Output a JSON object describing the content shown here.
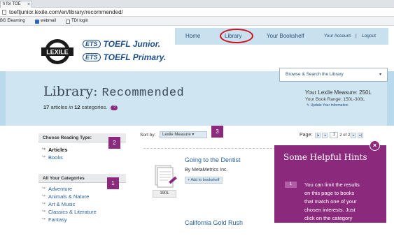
{
  "browser": {
    "tab_title": "h for TOE",
    "tab_close": "×",
    "url": "toefljunior.lexile.com/en/library/recommended/",
    "bookmarks": [
      "BG Elearning",
      "webmail",
      "TDI login"
    ]
  },
  "brand": {
    "lexile_logo_text": "LEXILE",
    "ets_badge": "ETS",
    "junior_name": "TOEFL Junior.",
    "primary_name": "TOEFL Primary."
  },
  "nav": {
    "home": "Home",
    "library": "Library",
    "bookshelf": "Your Bookshelf",
    "account": "Your Account",
    "separator": "|",
    "logout": "Logout"
  },
  "browse": {
    "label": "Browse & Search the Library",
    "caret": "▾"
  },
  "hero": {
    "title_prefix": "Library:",
    "title_suffix": "Recommended",
    "article_count": "17",
    "articles_word": "articles",
    "in_word": "in",
    "category_count": "12",
    "categories_word": "categories.",
    "help_glyph": "?",
    "measure_label": "Your Lexile Measure: 250L",
    "book_range": "Your Book Range:  150L-300L",
    "update_link": "Update Your Information",
    "update_glyph": "✎"
  },
  "sidebar": {
    "reading_type_header": "Choose Reading Type:",
    "reading_types": [
      "Articles",
      "Books"
    ],
    "categories_header": "All Your Categories",
    "categories": [
      "Adventure",
      "Animals & Nature",
      "Art & Music",
      "Classics & Literature",
      "Fantasy"
    ]
  },
  "tags": {
    "one": "1",
    "two": "2",
    "three": "3"
  },
  "sort": {
    "label": "Sort by:",
    "value": "Lexile Measure",
    "caret": "▾"
  },
  "pager": {
    "label": "Page:",
    "first": "|◂",
    "prev": "◂",
    "current": "1",
    "total": "2 of 2",
    "next": "▸",
    "last": "▸|"
  },
  "results": [
    {
      "title": "Going to the Dentist",
      "author": "By MetaMetrics Inc.",
      "add_label": "Add to bookshelf",
      "add_glyph": "+",
      "lexile": "190L"
    },
    {
      "title": "California Gold Rush"
    }
  ],
  "hints": {
    "title": "Some Helpful Hints",
    "step": "1",
    "lines": [
      "You can limit the results",
      "on this page to books",
      "that match one of your",
      "chosen interests. Just",
      "click on the category"
    ],
    "close": "×"
  },
  "colors": {
    "accent_purple": "#8b2a7d",
    "nav_bg": "#c9e0ef",
    "hero_bg": "#cfe5f2",
    "link_blue": "#2a62a0",
    "highlight_red": "#d0121b"
  }
}
